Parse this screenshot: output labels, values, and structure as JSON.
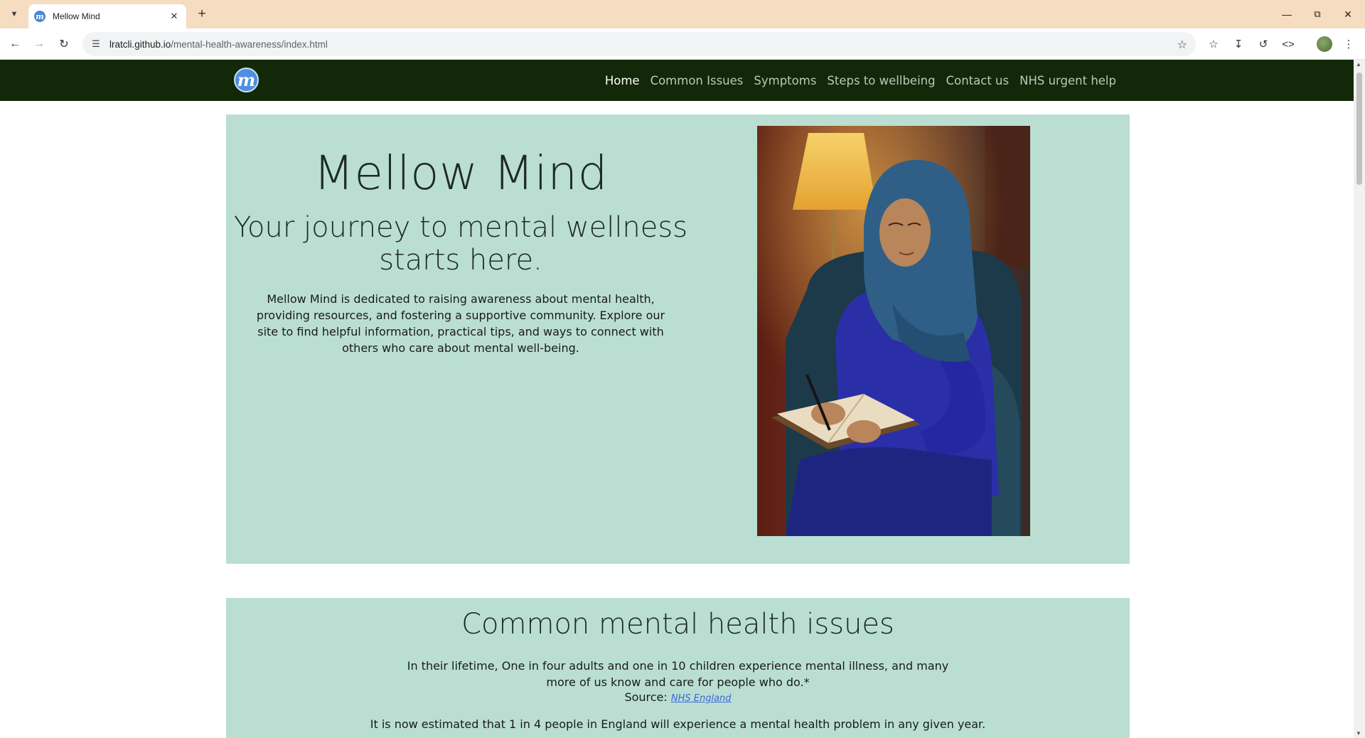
{
  "browser": {
    "tab_title": "Mellow Mind",
    "favicon_letter": "m",
    "url_host": "lratcli.github.io",
    "url_path": "/mental-health-awareness/index.html"
  },
  "site": {
    "logo_letter": "m",
    "nav": [
      {
        "label": "Home",
        "active": true
      },
      {
        "label": "Common Issues",
        "active": false
      },
      {
        "label": "Symptoms",
        "active": false
      },
      {
        "label": "Steps to wellbeing",
        "active": false
      },
      {
        "label": "Contact us",
        "active": false
      },
      {
        "label": "NHS urgent help",
        "active": false
      }
    ]
  },
  "hero": {
    "title": "Mellow Mind",
    "subtitle": "Your journey to mental wellness starts here.",
    "body": "Mellow Mind is dedicated to raising awareness about mental health, providing resources, and fostering a supportive community. Explore our site to find helpful information, practical tips, and ways to connect with others who care about mental well-being."
  },
  "issues": {
    "title": "Common mental health issues",
    "paragraph1": "In their lifetime, One in four adults and one in 10 children experience mental illness, and many more of us know and care for people who do.*",
    "source_label": "Source:",
    "source_link": "NHS England",
    "paragraph2": "It is now estimated that 1 in 4 people in England will experience a mental health problem in any given year."
  },
  "colors": {
    "tabstrip": "#f6dcc0",
    "site_nav_bg": "#122808",
    "section_bg": "#badfd2",
    "link": "#3b66d6"
  }
}
